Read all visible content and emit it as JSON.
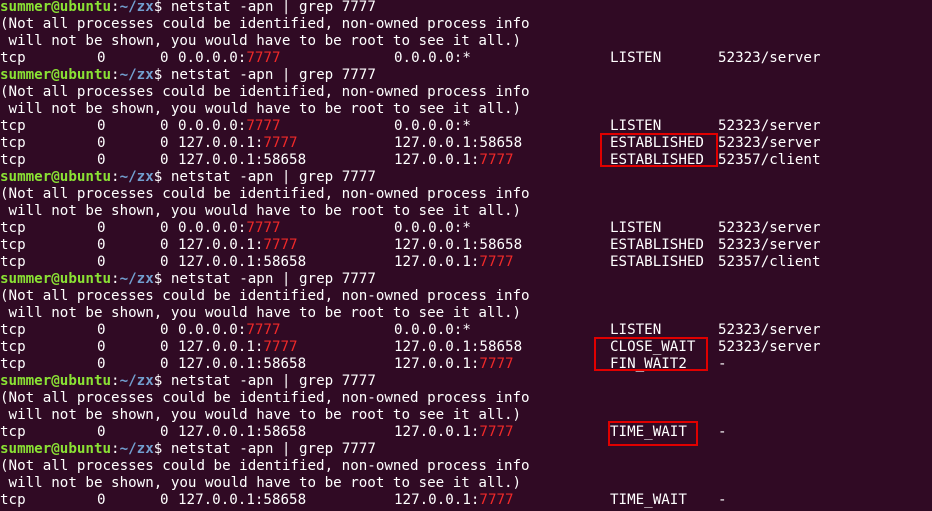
{
  "prompt": {
    "user": "summer@ubuntu",
    "colon": ":",
    "path": "~/zx",
    "symbol": "$ ",
    "command": "netstat -apn | grep 7777"
  },
  "warning": [
    "(Not all processes could be identified, non-owned process info",
    " will not be shown, you would have to be root to see it all.)"
  ],
  "port": "7777",
  "blocks": [
    {
      "rows": [
        {
          "proto": "tcp",
          "recvq": "0",
          "sendq": "0",
          "local": "0.0.0.0:",
          "local_port": "7777",
          "foreign": "0.0.0.0:*",
          "foreign_port": "",
          "state": "LISTEN",
          "pid": "52323/server"
        }
      ]
    },
    {
      "rows": [
        {
          "proto": "tcp",
          "recvq": "0",
          "sendq": "0",
          "local": "0.0.0.0:",
          "local_port": "7777",
          "foreign": "0.0.0.0:*",
          "foreign_port": "",
          "state": "LISTEN",
          "pid": "52323/server"
        },
        {
          "proto": "tcp",
          "recvq": "0",
          "sendq": "0",
          "local": "127.0.0.1:",
          "local_port": "7777",
          "foreign": "127.0.0.1:58658",
          "foreign_port": "",
          "state": "ESTABLISHED",
          "pid": "52323/server"
        },
        {
          "proto": "tcp",
          "recvq": "0",
          "sendq": "0",
          "local": "127.0.0.1:58658",
          "local_port": "",
          "foreign": "127.0.0.1:",
          "foreign_port": "7777",
          "state": "ESTABLISHED",
          "pid": "52357/client"
        }
      ]
    },
    {
      "rows": [
        {
          "proto": "tcp",
          "recvq": "0",
          "sendq": "0",
          "local": "0.0.0.0:",
          "local_port": "7777",
          "foreign": "0.0.0.0:*",
          "foreign_port": "",
          "state": "LISTEN",
          "pid": "52323/server"
        },
        {
          "proto": "tcp",
          "recvq": "0",
          "sendq": "0",
          "local": "127.0.0.1:",
          "local_port": "7777",
          "foreign": "127.0.0.1:58658",
          "foreign_port": "",
          "state": "ESTABLISHED",
          "pid": "52323/server"
        },
        {
          "proto": "tcp",
          "recvq": "0",
          "sendq": "0",
          "local": "127.0.0.1:58658",
          "local_port": "",
          "foreign": "127.0.0.1:",
          "foreign_port": "7777",
          "state": "ESTABLISHED",
          "pid": "52357/client"
        }
      ]
    },
    {
      "rows": [
        {
          "proto": "tcp",
          "recvq": "0",
          "sendq": "0",
          "local": "0.0.0.0:",
          "local_port": "7777",
          "foreign": "0.0.0.0:*",
          "foreign_port": "",
          "state": "LISTEN",
          "pid": "52323/server"
        },
        {
          "proto": "tcp",
          "recvq": "0",
          "sendq": "0",
          "local": "127.0.0.1:",
          "local_port": "7777",
          "foreign": "127.0.0.1:58658",
          "foreign_port": "",
          "state": "CLOSE_WAIT",
          "pid": "52323/server"
        },
        {
          "proto": "tcp",
          "recvq": "0",
          "sendq": "0",
          "local": "127.0.0.1:58658",
          "local_port": "",
          "foreign": "127.0.0.1:",
          "foreign_port": "7777",
          "state": "FIN_WAIT2",
          "pid": "-"
        }
      ]
    },
    {
      "rows": [
        {
          "proto": "tcp",
          "recvq": "0",
          "sendq": "0",
          "local": "127.0.0.1:58658",
          "local_port": "",
          "foreign": "127.0.0.1:",
          "foreign_port": "7777",
          "state": "TIME_WAIT",
          "pid": "-"
        }
      ]
    },
    {
      "rows": [
        {
          "proto": "tcp",
          "recvq": "0",
          "sendq": "0",
          "local": "127.0.0.1:58658",
          "local_port": "",
          "foreign": "127.0.0.1:",
          "foreign_port": "7777",
          "state": "TIME_WAIT",
          "pid": "-"
        }
      ]
    }
  ],
  "colors": {
    "background": "#300a24",
    "text": "#ffffff",
    "prompt_user": "#8ae234",
    "prompt_path": "#729fcf",
    "port_match": "#ef2929",
    "annotation_box": "#e00000"
  }
}
